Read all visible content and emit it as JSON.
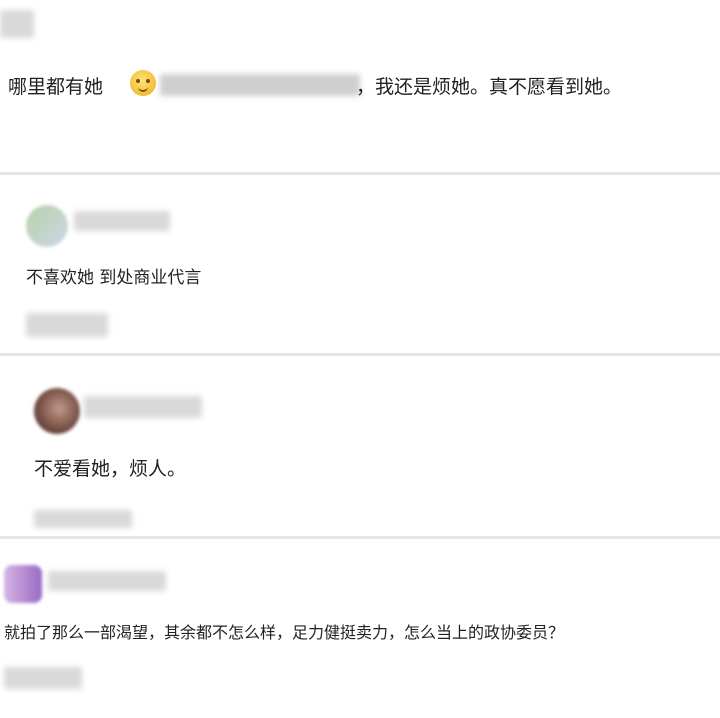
{
  "comments": [
    {
      "text_before": "哪里都有她",
      "text_after": "，我还是烦她。真不愿看到她。",
      "emoji_icon": "thinking-face-emoji"
    },
    {
      "text": "不喜欢她 到处商业代言"
    },
    {
      "text": "不爱看她，烦人。"
    },
    {
      "text": "就拍了那么一部渴望，其余都不怎么样，足力健挺卖力，怎么当上的政协委员？"
    }
  ],
  "colors": {
    "divider": "#e6e6e6",
    "text": "#222222",
    "blur": "#d9d9d9"
  }
}
